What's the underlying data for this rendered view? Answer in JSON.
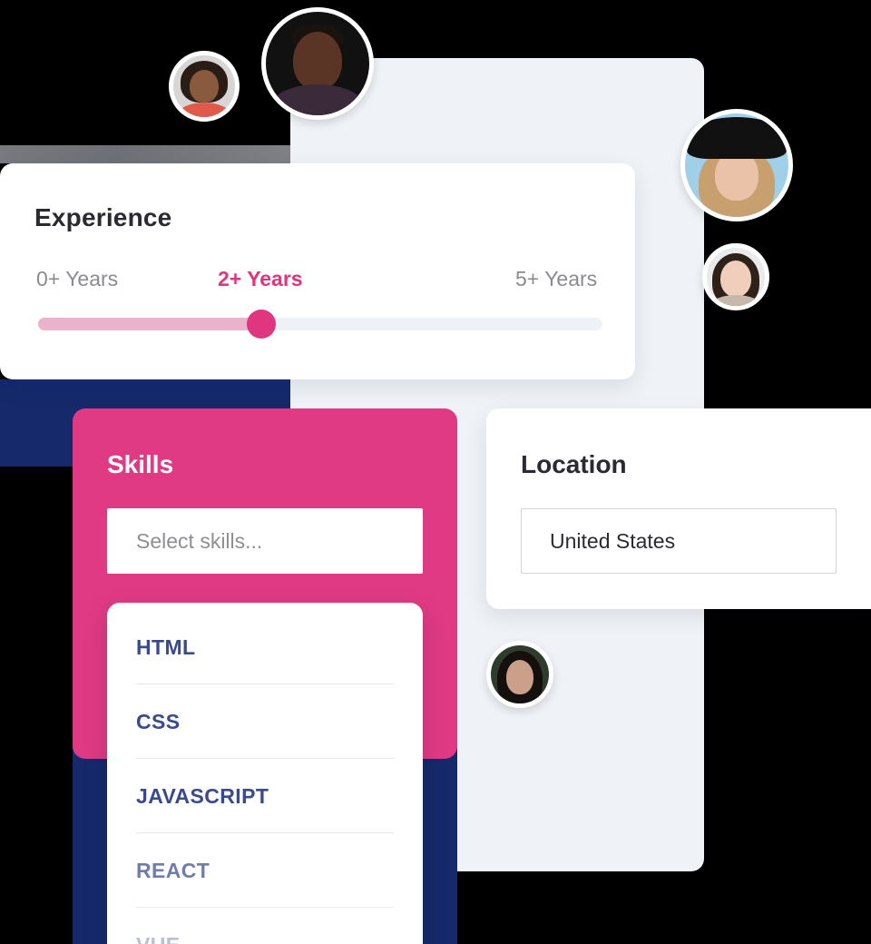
{
  "experience": {
    "title": "Experience",
    "labels": {
      "low": "0+ Years",
      "selected": "2+ Years",
      "high": "5+ Years"
    },
    "slider_fraction": 0.395
  },
  "skills": {
    "title": "Skills",
    "placeholder": "Select skills...",
    "options": [
      "HTML",
      "CSS",
      "JAVASCRIPT",
      "REACT",
      "VUE"
    ]
  },
  "location": {
    "title": "Location",
    "value": "United States"
  },
  "colors": {
    "accent": "#e0357f",
    "navy": "#16296b",
    "skill_text": "#3a4a8c"
  }
}
